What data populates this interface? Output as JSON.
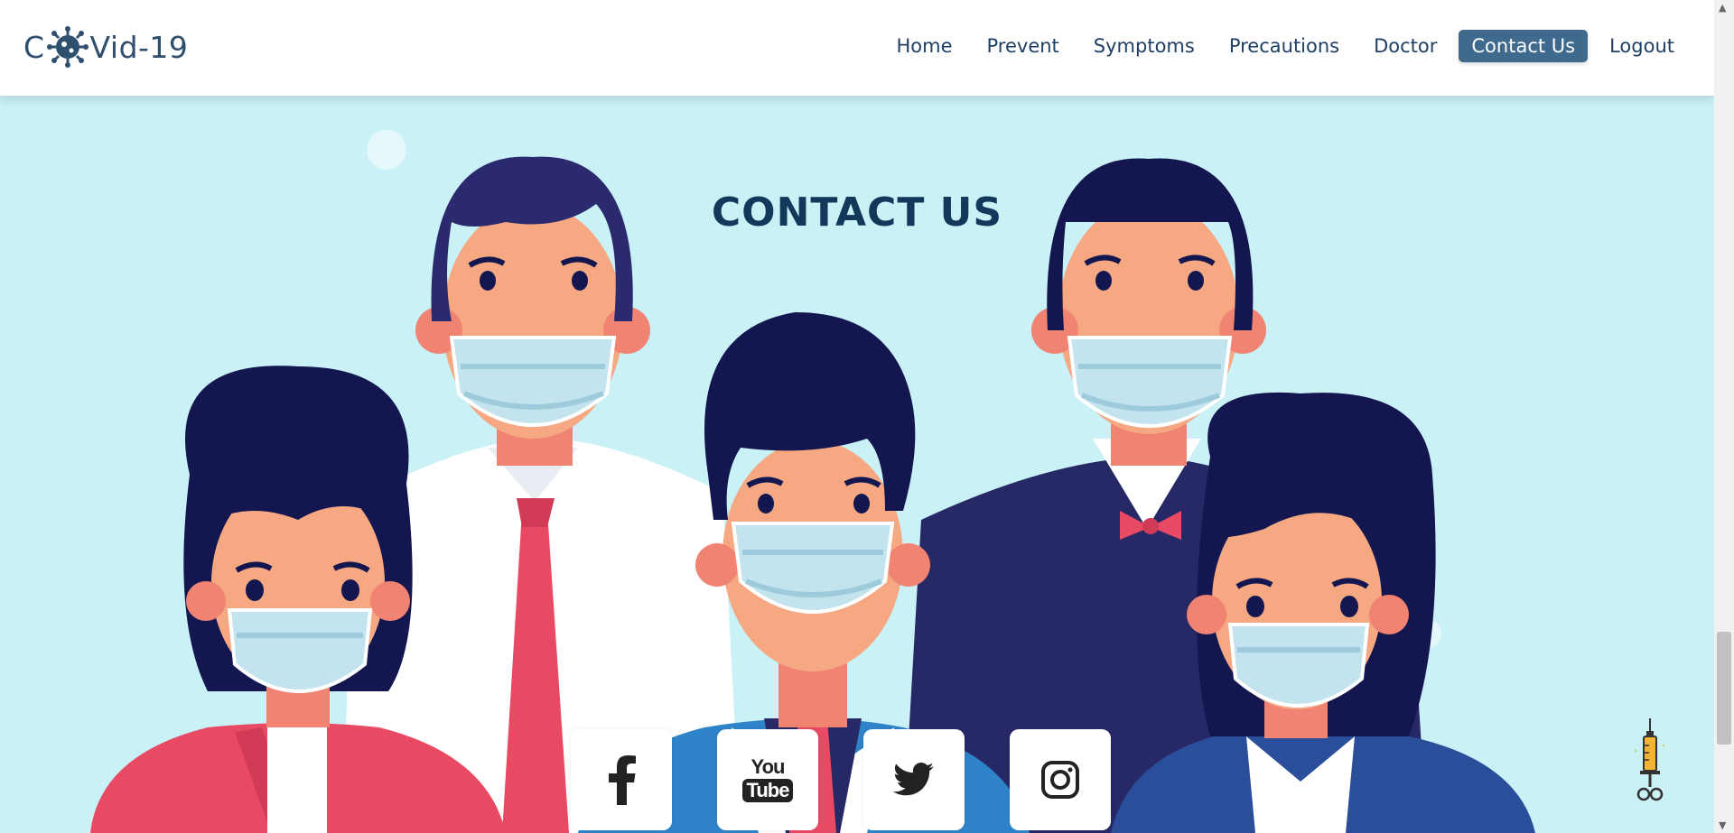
{
  "header": {
    "logo_left": "C",
    "logo_right": "Vid-19",
    "nav": [
      {
        "label": "Home"
      },
      {
        "label": "Prevent"
      },
      {
        "label": "Symptoms"
      },
      {
        "label": "Precautions"
      },
      {
        "label": "Doctor"
      },
      {
        "label": "Contact Us",
        "active": true
      },
      {
        "label": "Logout"
      }
    ]
  },
  "hero": {
    "title": "CONTACT US",
    "socials": [
      "facebook-icon",
      "youtube-icon",
      "twitter-icon",
      "instagram-icon"
    ],
    "youtube_you": "You",
    "youtube_tube": "Tube"
  },
  "colors": {
    "brand": "#2f4f6e",
    "active_nav": "#3f6a8d",
    "background": "#c9f1f6",
    "hair": "#141650",
    "skin": "#f5a882",
    "mask": "#c3e3ee",
    "tie": "#e84a64",
    "jacket": "#2f84c9"
  }
}
